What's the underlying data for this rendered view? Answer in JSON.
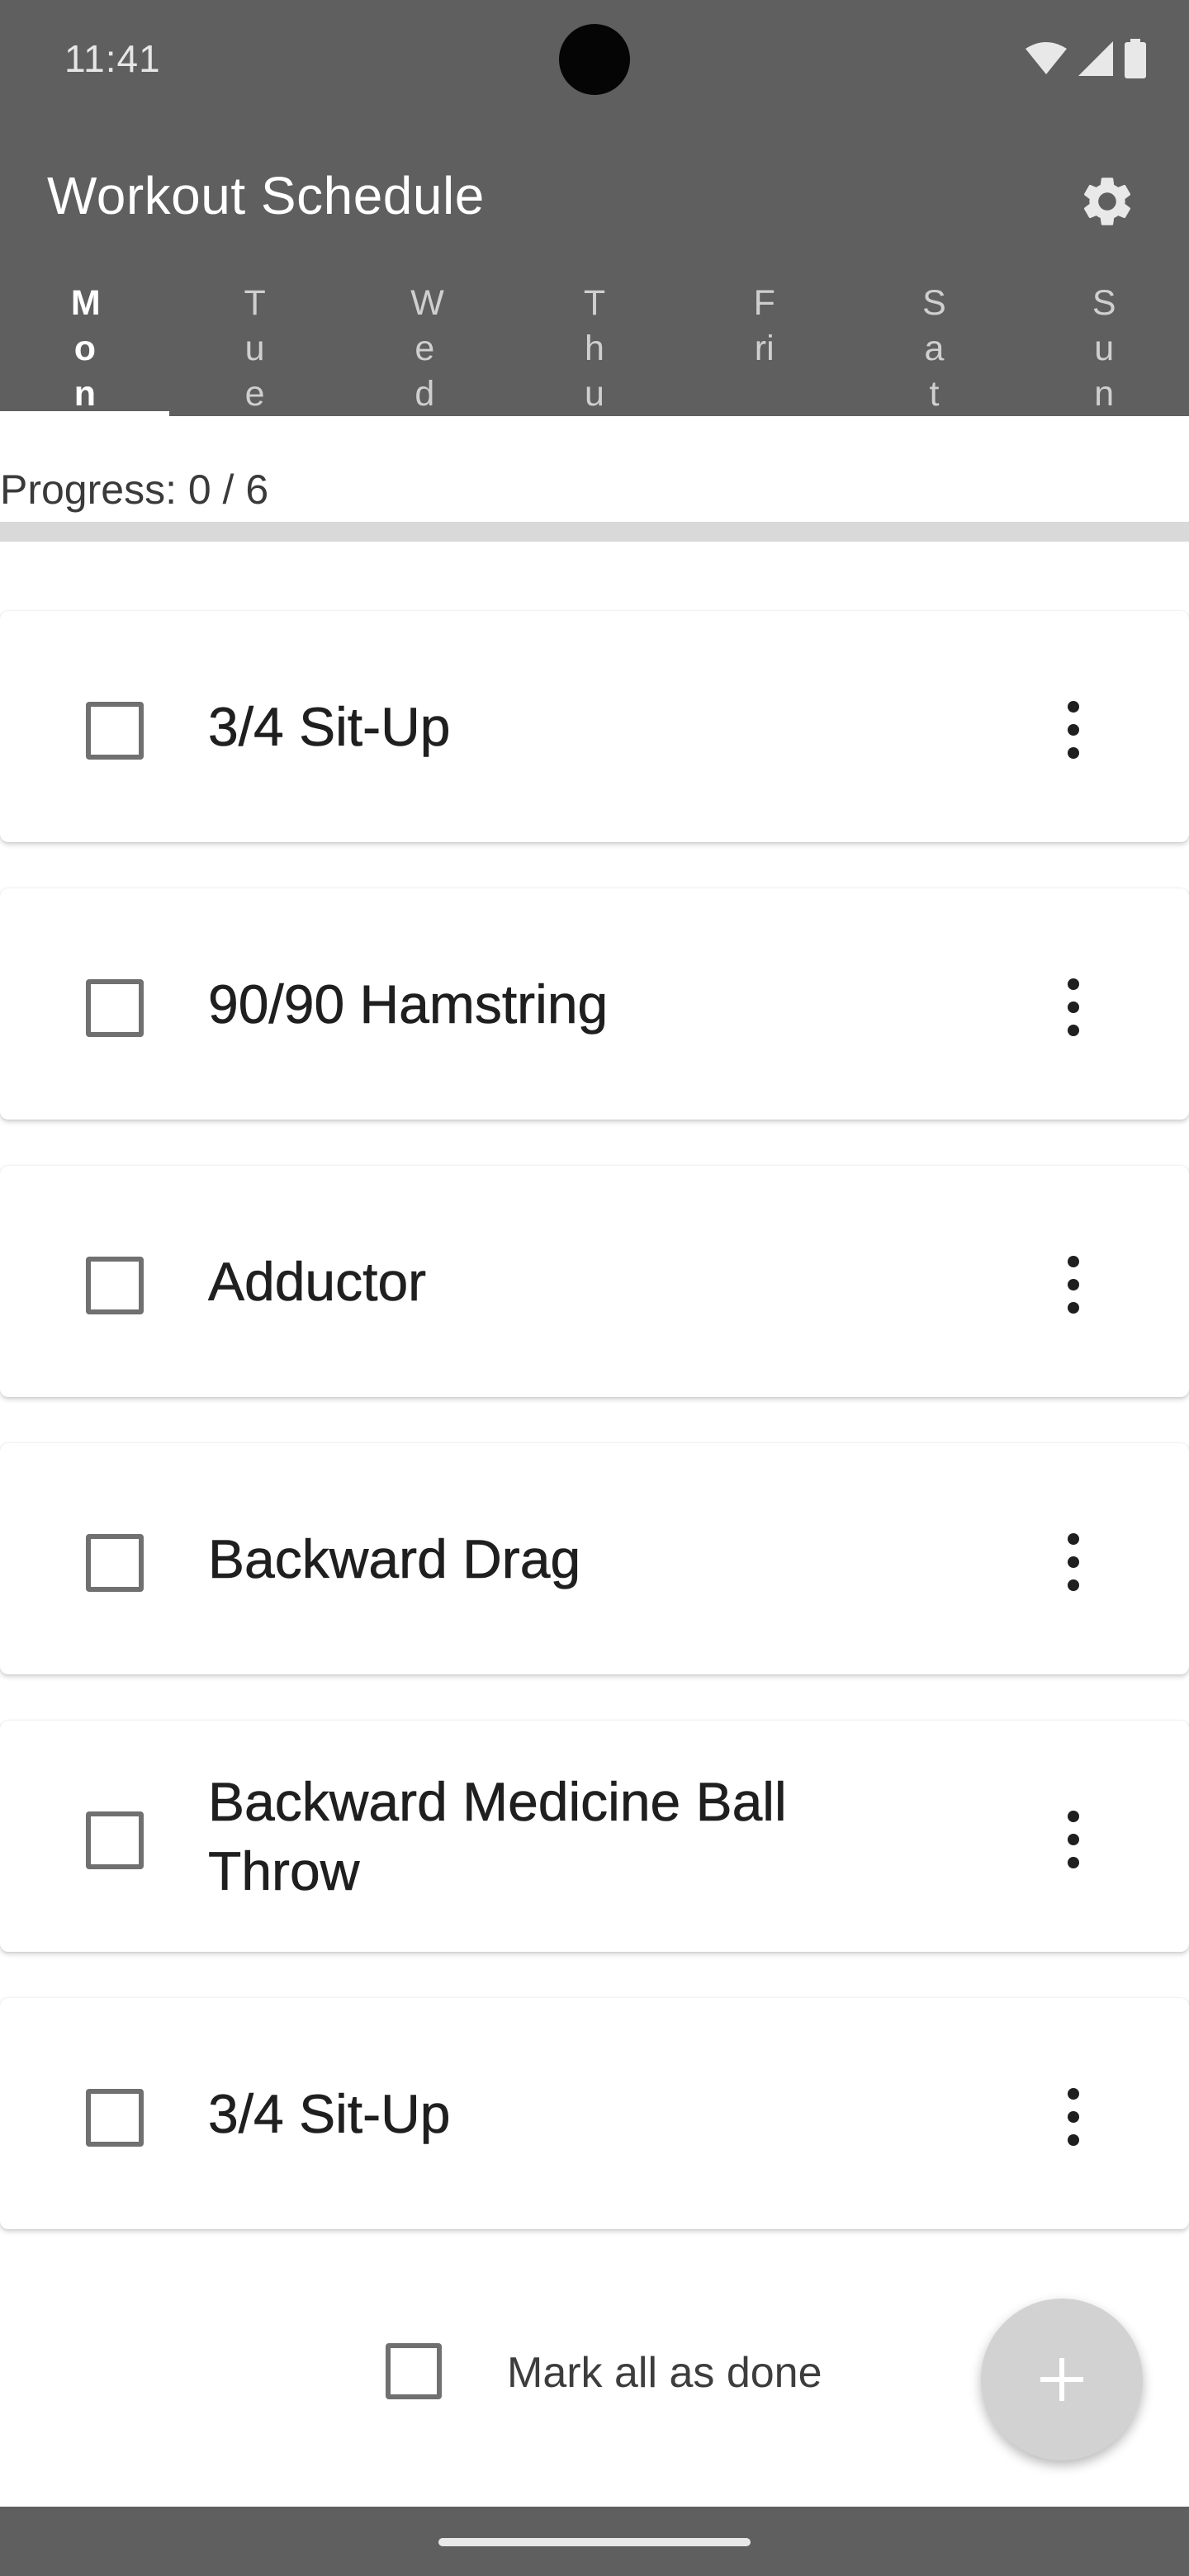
{
  "status_bar": {
    "time": "11:41"
  },
  "app_bar": {
    "title": "Workout Schedule",
    "settings_icon": "gear-icon"
  },
  "tabs": [
    {
      "label": "Mon",
      "active": true
    },
    {
      "label": "Tue",
      "active": false
    },
    {
      "label": "Wed",
      "active": false
    },
    {
      "label": "Thu",
      "active": false
    },
    {
      "label": "Fri",
      "active": false
    },
    {
      "label": "Sat",
      "active": false
    },
    {
      "label": "Sun",
      "active": false
    }
  ],
  "progress": {
    "text": "Progress: 0 / 6",
    "done": 0,
    "total": 6
  },
  "exercises": [
    {
      "name": "3/4 Sit-Up",
      "checked": false
    },
    {
      "name": "90/90 Hamstring",
      "checked": false
    },
    {
      "name": "Adductor",
      "checked": false
    },
    {
      "name": "Backward Drag",
      "checked": false
    },
    {
      "name": "Backward Medicine Ball Throw",
      "checked": false
    },
    {
      "name": "3/4 Sit-Up",
      "checked": false
    }
  ],
  "footer": {
    "mark_all_label": "Mark all as done",
    "fab_icon": "plus-icon"
  },
  "colors": {
    "app_bar": "#5f5f5f",
    "fab": "#d2d2d2"
  }
}
